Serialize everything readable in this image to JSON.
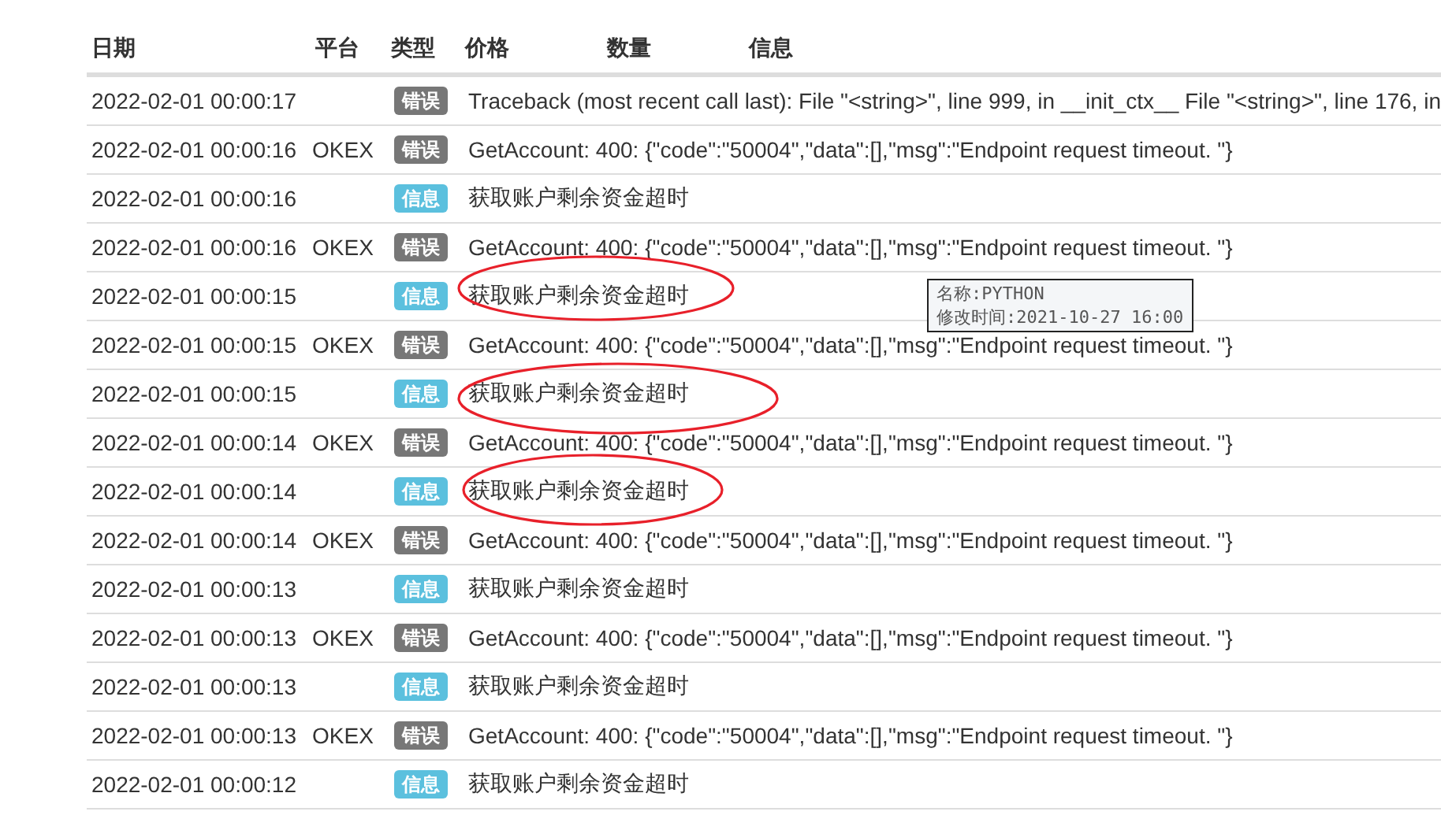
{
  "table": {
    "columns": [
      "日期",
      "平台",
      "类型",
      "价格",
      "数量",
      "信息"
    ],
    "rows": [
      {
        "date": "2022-02-01 00:00:17",
        "platform": "",
        "type": {
          "kind": "error",
          "label": "错误"
        },
        "message": "Traceback (most recent call last): File \"<string>\", line 999, in __init_ctx__ File \"<string>\", line 176, in"
      },
      {
        "date": "2022-02-01 00:00:16",
        "platform": "OKEX",
        "type": {
          "kind": "error",
          "label": "错误"
        },
        "message": "GetAccount: 400: {\"code\":\"50004\",\"data\":[],\"msg\":\"Endpoint request timeout. \"}"
      },
      {
        "date": "2022-02-01 00:00:16",
        "platform": "",
        "type": {
          "kind": "info",
          "label": "信息"
        },
        "message": "获取账户剩余资金超时"
      },
      {
        "date": "2022-02-01 00:00:16",
        "platform": "OKEX",
        "type": {
          "kind": "error",
          "label": "错误"
        },
        "message": "GetAccount: 400: {\"code\":\"50004\",\"data\":[],\"msg\":\"Endpoint request timeout. \"}"
      },
      {
        "date": "2022-02-01 00:00:15",
        "platform": "",
        "type": {
          "kind": "info",
          "label": "信息"
        },
        "message": "获取账户剩余资金超时"
      },
      {
        "date": "2022-02-01 00:00:15",
        "platform": "OKEX",
        "type": {
          "kind": "error",
          "label": "错误"
        },
        "message": "GetAccount: 400: {\"code\":\"50004\",\"data\":[],\"msg\":\"Endpoint request timeout. \"}"
      },
      {
        "date": "2022-02-01 00:00:15",
        "platform": "",
        "type": {
          "kind": "info",
          "label": "信息"
        },
        "message": "获取账户剩余资金超时"
      },
      {
        "date": "2022-02-01 00:00:14",
        "platform": "OKEX",
        "type": {
          "kind": "error",
          "label": "错误"
        },
        "message": "GetAccount: 400: {\"code\":\"50004\",\"data\":[],\"msg\":\"Endpoint request timeout. \"}"
      },
      {
        "date": "2022-02-01 00:00:14",
        "platform": "",
        "type": {
          "kind": "info",
          "label": "信息"
        },
        "message": "获取账户剩余资金超时"
      },
      {
        "date": "2022-02-01 00:00:14",
        "platform": "OKEX",
        "type": {
          "kind": "error",
          "label": "错误"
        },
        "message": "GetAccount: 400: {\"code\":\"50004\",\"data\":[],\"msg\":\"Endpoint request timeout. \"}"
      },
      {
        "date": "2022-02-01 00:00:13",
        "platform": "",
        "type": {
          "kind": "info",
          "label": "信息"
        },
        "message": "获取账户剩余资金超时"
      },
      {
        "date": "2022-02-01 00:00:13",
        "platform": "OKEX",
        "type": {
          "kind": "error",
          "label": "错误"
        },
        "message": "GetAccount: 400: {\"code\":\"50004\",\"data\":[],\"msg\":\"Endpoint request timeout. \"}"
      },
      {
        "date": "2022-02-01 00:00:13",
        "platform": "",
        "type": {
          "kind": "info",
          "label": "信息"
        },
        "message": "获取账户剩余资金超时"
      },
      {
        "date": "2022-02-01 00:00:13",
        "platform": "OKEX",
        "type": {
          "kind": "error",
          "label": "错误"
        },
        "message": "GetAccount: 400: {\"code\":\"50004\",\"data\":[],\"msg\":\"Endpoint request timeout. \"}"
      },
      {
        "date": "2022-02-01 00:00:12",
        "platform": "",
        "type": {
          "kind": "info",
          "label": "信息"
        },
        "message": "获取账户剩余资金超时"
      }
    ]
  },
  "tooltip": {
    "lines": [
      "名称:PYTHON",
      "修改时间:2021-10-27 16:00"
    ]
  }
}
